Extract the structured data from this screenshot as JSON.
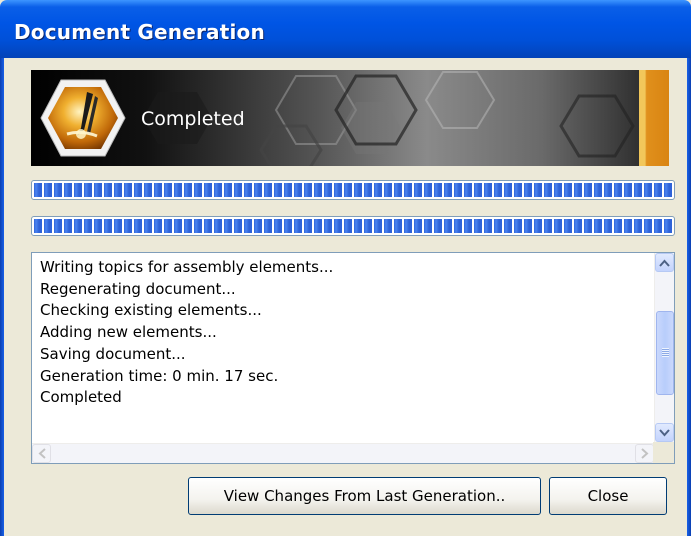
{
  "window": {
    "title": "Document Generation"
  },
  "banner": {
    "status": "Completed"
  },
  "progress": [
    {
      "value_fraction": 1.0
    },
    {
      "value_fraction": 1.0
    }
  ],
  "log": {
    "lines": [
      "Writing topics for assembly elements...",
      "Regenerating document...",
      "Checking existing elements...",
      "Adding new elements...",
      "Saving document...",
      "Generation time: 0 min. 17 sec.",
      "Completed"
    ]
  },
  "buttons": {
    "view_changes": "View Changes From Last Generation..",
    "close": "Close"
  },
  "icons": {
    "logo": "pen-hexagon-logo-icon",
    "scroll_up": "arrow-up-icon",
    "scroll_down": "arrow-down-icon",
    "scroll_left": "arrow-left-icon",
    "scroll_right": "arrow-right-icon"
  },
  "colors": {
    "titlebar": "#0055e5",
    "progress_fill": "#2f63d8",
    "banner_accent": "#d98412"
  }
}
